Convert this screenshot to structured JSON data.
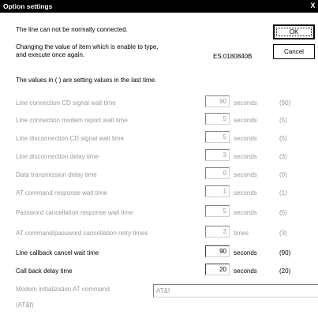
{
  "window": {
    "title": "Option settings",
    "close_glyph": "X"
  },
  "messages": {
    "line_status": "The line can not be normally connected.",
    "instruction_line1": "Changing the value of item which is enable to type,",
    "instruction_line2": "and execute once again.",
    "error_code": "ES:0180840B",
    "values_note": "The values in ( ) are setting values in the last time."
  },
  "buttons": {
    "ok_label": "OK",
    "cancel_label": "Cancel"
  },
  "settings": [
    {
      "label": "Line connection CD signal wait time",
      "value": "90",
      "unit": "seconds",
      "last": "(90)",
      "enabled": false
    },
    {
      "label": "Line connection modem report wait time",
      "value": "5",
      "unit": "seconds",
      "last": "(5)",
      "enabled": false
    },
    {
      "label": "Line disconnection CD signal wait time",
      "value": "5",
      "unit": "seconds",
      "last": "(5)",
      "enabled": false
    },
    {
      "label": "Line disconnection delay time",
      "value": "3",
      "unit": "seconds",
      "last": "(3)",
      "enabled": false
    },
    {
      "label": "Data transmission delay time",
      "value": "0",
      "unit": "seconds",
      "last": "(0)",
      "enabled": false
    },
    {
      "label": "AT command response wait time",
      "value": "1",
      "unit": "seconds",
      "last": "(1)",
      "enabled": false
    },
    {
      "label": "Password cancellation response wait time",
      "value": "5",
      "unit": "seconds",
      "last": "(5)",
      "enabled": false
    },
    {
      "label": "AT command/password cancellation retry times",
      "value": "3",
      "unit": "times",
      "last": "(3)",
      "enabled": false
    },
    {
      "label": "Line callback cancel wait time",
      "value": "90",
      "unit": "seconds",
      "last": "(90)",
      "enabled": true
    },
    {
      "label": "Call back delay time",
      "value": "20",
      "unit": "seconds",
      "last": "(20)",
      "enabled": true
    }
  ],
  "modem_init": {
    "label": "Modem initialization AT command",
    "value": "AT&f",
    "last": "(AT&f)"
  }
}
